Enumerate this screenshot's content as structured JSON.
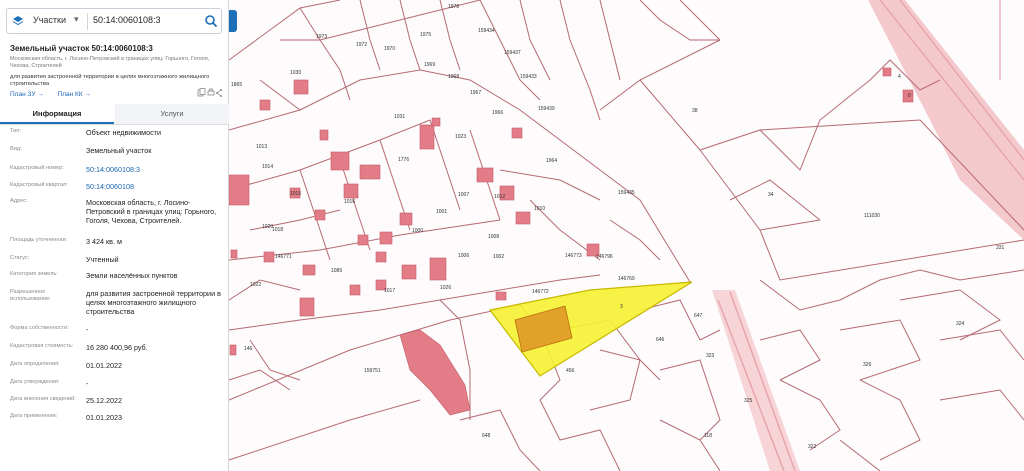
{
  "search": {
    "layer": "Участки",
    "query": "50:14:0060108:3"
  },
  "card": {
    "title": "Земельный участок 50:14:0060108:3",
    "address_short": "Московская область, г. Лосино-Петровский в границах улиц: Горьного, Гоголя, Чехова, Строителей",
    "purpose": "для развития застроенной территории в целях многоэтажного жилищного строительства",
    "link_plan_zu": "План ЗУ →",
    "link_plan_kk": "План КК →"
  },
  "tabs": {
    "info": "Информация",
    "services": "Услуги"
  },
  "props": [
    {
      "label": "Тип:",
      "value": "Объект недвижимости"
    },
    {
      "label": "Вид:",
      "value": "Земельный участок"
    },
    {
      "label": "Кадастровый номер:",
      "value": "50:14:0060108:3"
    },
    {
      "label": "Кадастровый квартал:",
      "value": "50:14:0060108"
    },
    {
      "label": "Адрес:",
      "value": "Московская область, г. Лосино-Петровский в границах улиц: Горьного, Гоголя, Чехова, Строителей."
    },
    {
      "label": "Площадь уточненная:",
      "value": "3 424 кв. м"
    },
    {
      "label": "Статус:",
      "value": "Учтенный"
    },
    {
      "label": "Категория земель:",
      "value": "Земли населённых пунктов"
    },
    {
      "label": "Разрешенное использование:",
      "value": "для развития застроенной территории в целях многоэтажного жилищного строительства"
    },
    {
      "label": "Форма собственности:",
      "value": "-"
    },
    {
      "label": "Кадастровая стоимость:",
      "value": "16 280 400,96 руб."
    },
    {
      "label": "Дата определения:",
      "value": "01.01.2022"
    },
    {
      "label": "Дата утверждения:",
      "value": "-"
    },
    {
      "label": "Дата внесения сведений:",
      "value": "25.12.2022"
    },
    {
      "label": "Дата применения:",
      "value": "01.01.2023"
    }
  ],
  "map_labels": {
    "l1973": "1973",
    "l1972": "1972",
    "l1970": "1970",
    "l1975": "1975",
    "l1978": "1978",
    "l1969": "1969",
    "l1968": "1968",
    "l1967": "1967",
    "l1966": "1966",
    "l1964": "1964",
    "l159434": "159434",
    "l159433": "159433",
    "l159437": "159437",
    "l159439": "159439",
    "l1865": "1865",
    "l1030": "1030",
    "l1031": "1031",
    "l1023": "1023",
    "l1013": "1013",
    "l1014": "1014",
    "l1015": "1015",
    "l1016": "1016",
    "l1018": "1018",
    "l1020": "1020",
    "l1776": "1776",
    "l1007": "1007",
    "l1008": "1008",
    "l1010": "1010",
    "l1012": "1012",
    "l1002": "1002",
    "l1001": "1001",
    "l1000": "1000",
    "l1006": "1006",
    "l1089": "1089",
    "l1017": "1017",
    "l1022": "1022",
    "l1026": "1026",
    "l146771": "146771",
    "l146772": "146772",
    "l146773": "146773",
    "l146769": "146769",
    "l146796": "146796",
    "l159435": "159435",
    "l159751": "159751",
    "l146": "146",
    "l38": "38",
    "l34": "34",
    "l111030": "111030",
    "l331": "331",
    "l647": "647",
    "l646": "646",
    "l323": "323",
    "l324": "324",
    "l326": "326",
    "l325": "325",
    "l118": "118",
    "l322": "322",
    "l456": "456",
    "l648": "648",
    "l3": "3",
    "l4": "4",
    "l8": "8"
  }
}
